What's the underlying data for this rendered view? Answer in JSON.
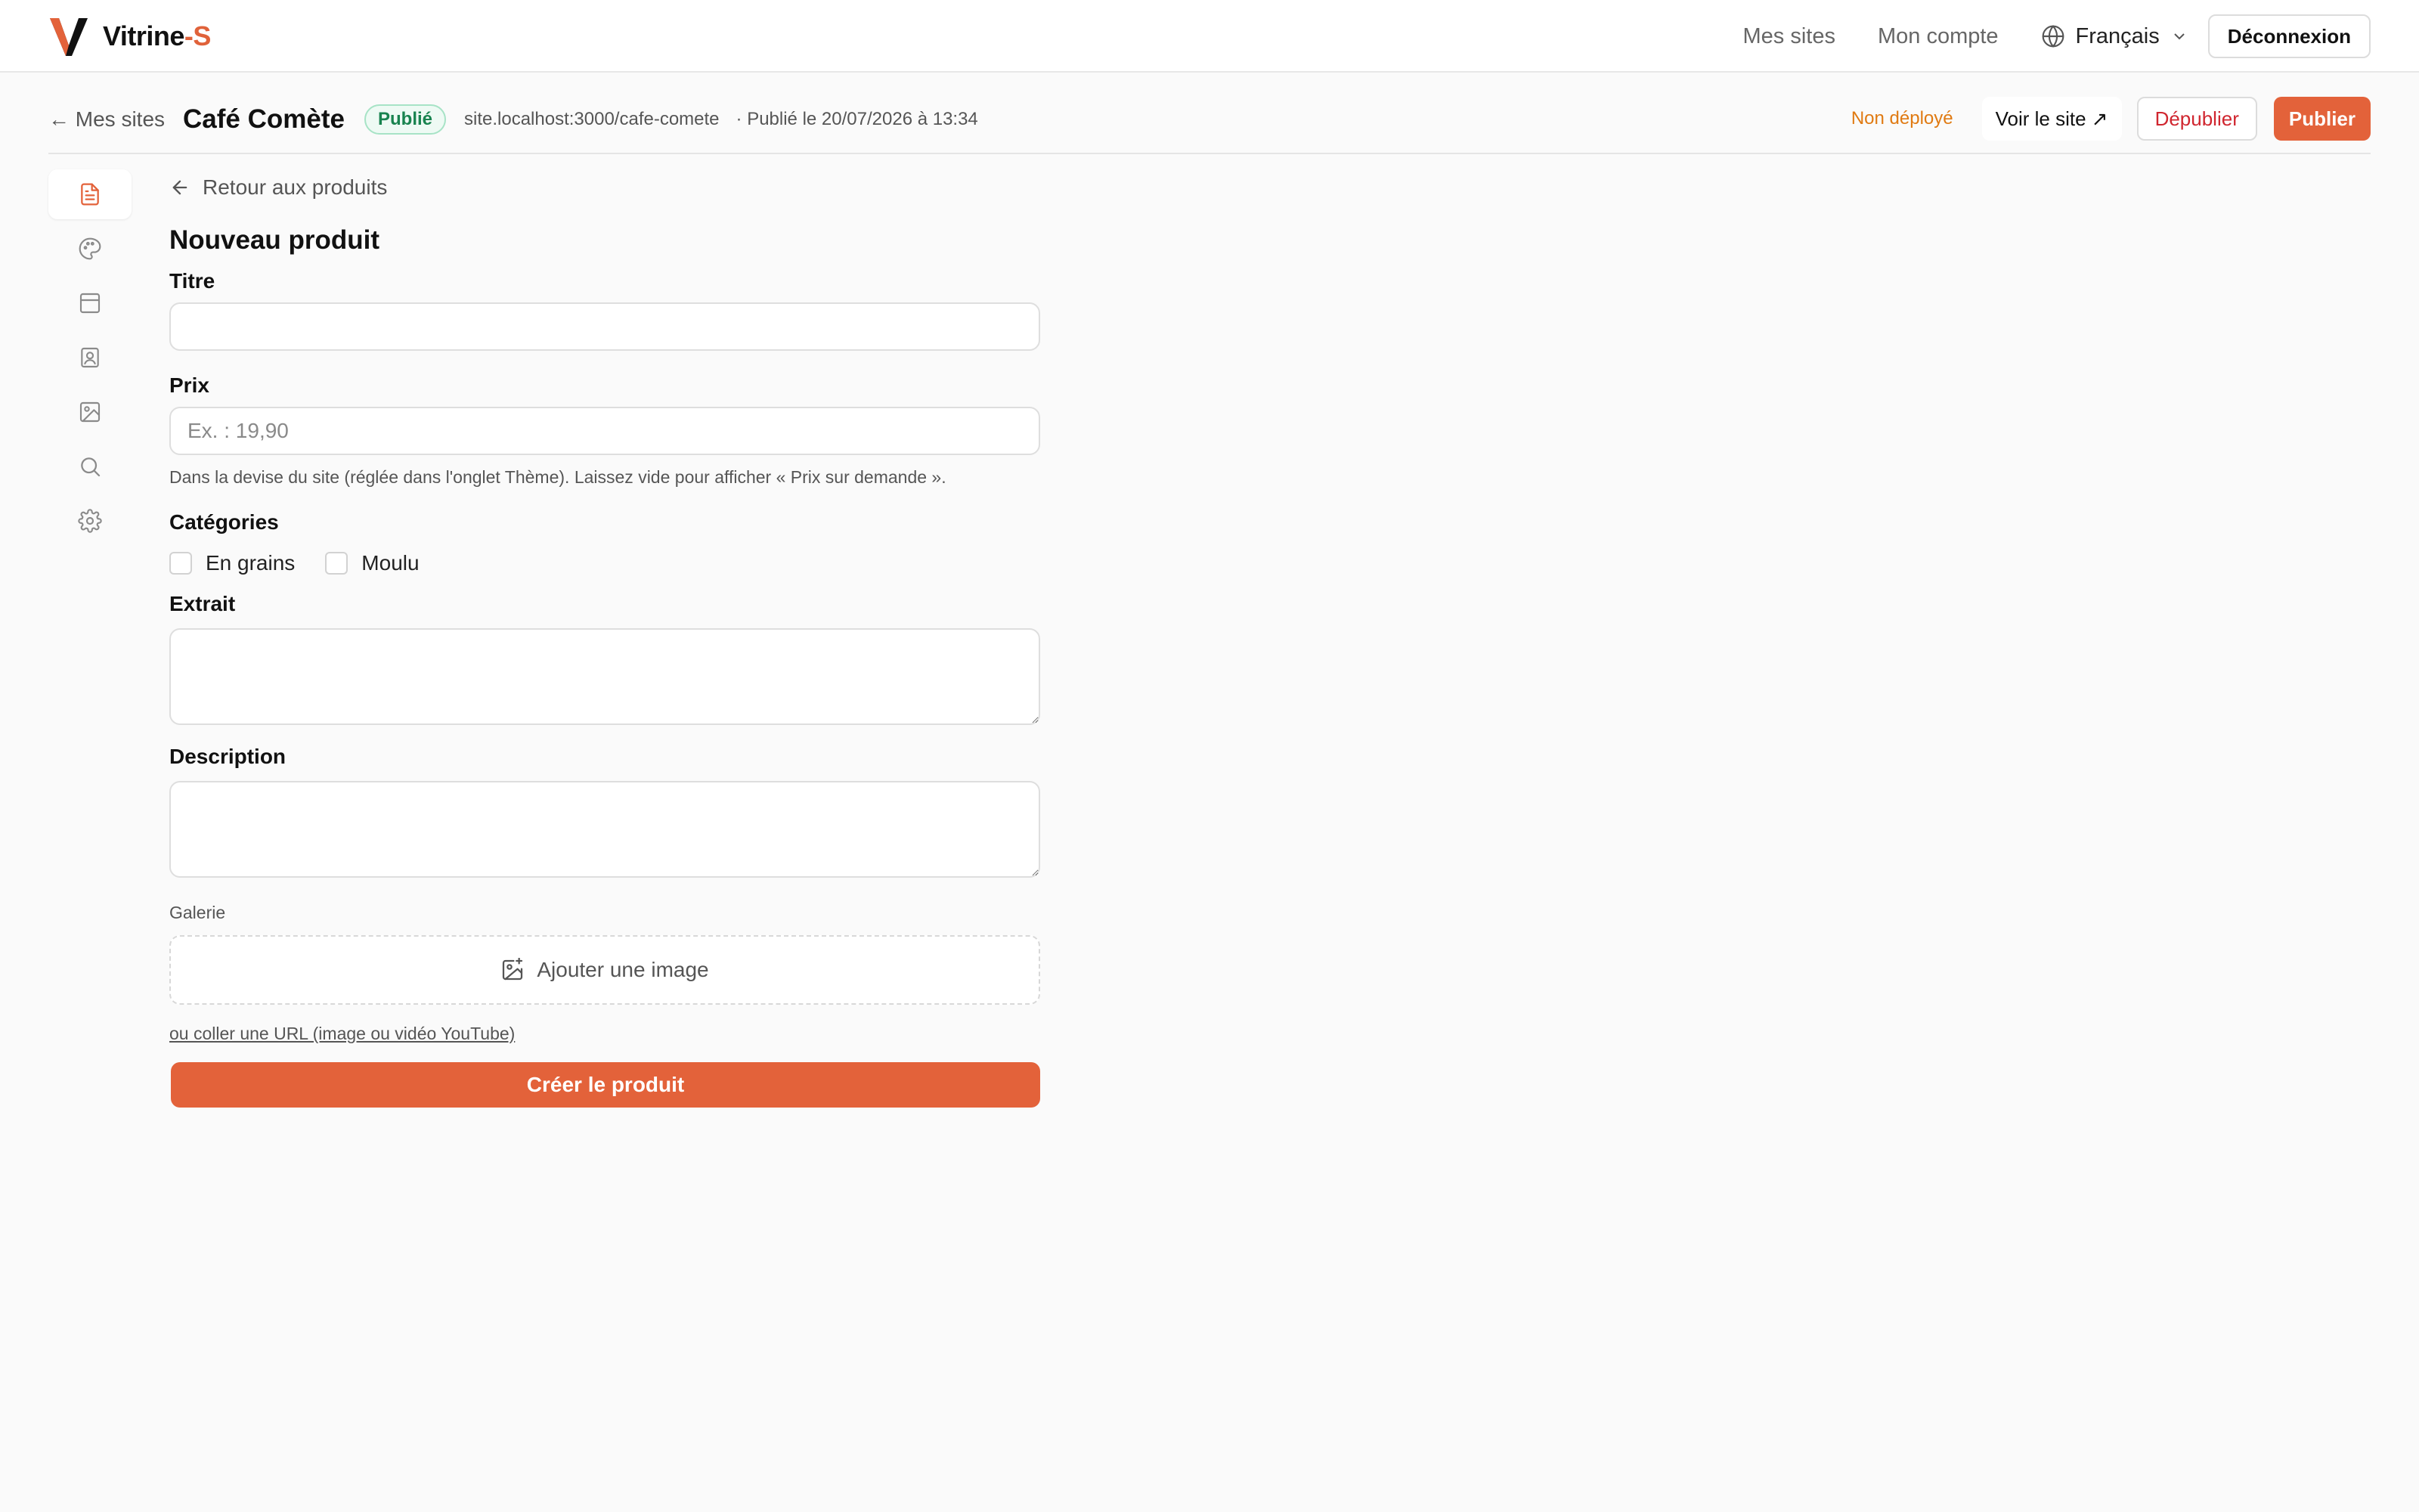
{
  "brand": {
    "name_part": "Vitrine",
    "name_accent": "-S",
    "accent_color": "#e3623a"
  },
  "topnav": {
    "my_sites": "Mes sites",
    "my_account": "Mon compte",
    "language": "Français",
    "logout": "Déconnexion"
  },
  "sitebar": {
    "back_label": "← Mes sites",
    "site_name": "Café Comète",
    "status_badge": "Publié",
    "site_url": "site.localhost:3000/cafe-comete",
    "published_on": "· Publié le 20/07/2026 à 13:34",
    "deploy_status": "Non déployé",
    "view_site": "Voir le site ↗",
    "unpublish": "Dépublier",
    "publish": "Publier"
  },
  "rail": {
    "items": [
      "pages-icon",
      "palette-icon",
      "layout-icon",
      "contact-icon",
      "image-icon",
      "search-icon",
      "gear-icon"
    ],
    "active": "pages-icon"
  },
  "form": {
    "back_label": "Retour aux produits",
    "title": "Nouveau produit",
    "title_label": "Titre",
    "title_value": "",
    "price_label": "Prix",
    "price_value": "",
    "price_placeholder": "Ex. : 19,90",
    "price_help": "Dans la devise du site (réglée dans l'onglet Thème). Laissez vide pour afficher « Prix sur demande ».",
    "categories_label": "Catégories",
    "categories": [
      {
        "label": "En grains",
        "checked": false
      },
      {
        "label": "Moulu",
        "checked": false
      }
    ],
    "excerpt_label": "Extrait",
    "excerpt_value": "",
    "description_label": "Description",
    "description_value": "",
    "gallery_label": "Galerie",
    "add_image": "Ajouter une image",
    "paste_url": "ou coller une URL (image ou vidéo YouTube)",
    "submit": "Créer le produit"
  }
}
